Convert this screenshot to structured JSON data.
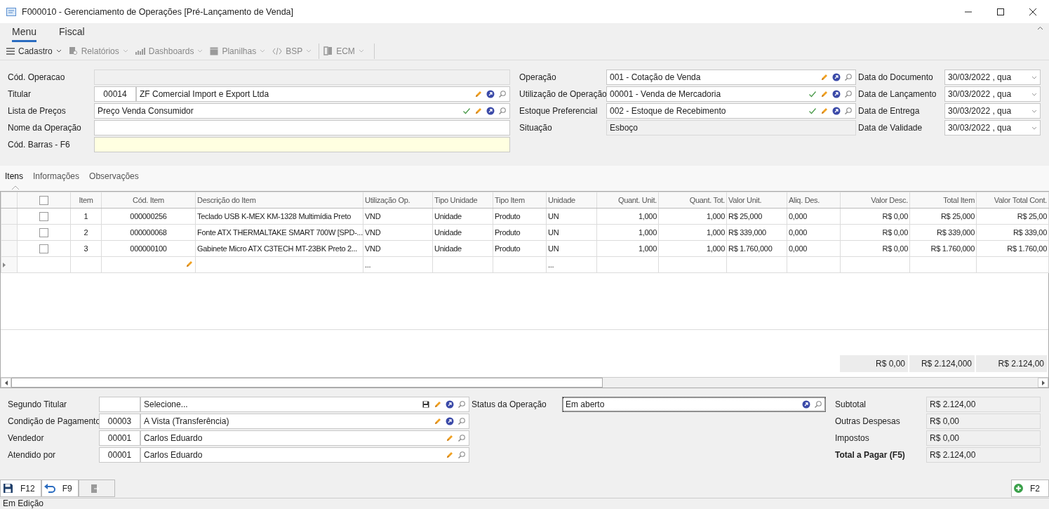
{
  "window": {
    "title": "F000010 - Gerenciamento de Operações [Pré-Lançamento de Venda]"
  },
  "ribbon_tabs": [
    {
      "label": "Menu",
      "selected": true
    },
    {
      "label": "Fiscal",
      "selected": false
    }
  ],
  "toolbar": [
    {
      "label": "Cadastro",
      "kind": "menu",
      "disabled": false
    },
    {
      "label": "Relatórios",
      "kind": "reports",
      "disabled": true
    },
    {
      "label": "Dashboards",
      "kind": "dashboards",
      "disabled": true
    },
    {
      "label": "Planilhas",
      "kind": "sheets",
      "disabled": true
    },
    {
      "label": "BSP",
      "kind": "code",
      "disabled": true
    },
    {
      "label": "ECM",
      "kind": "ecm",
      "disabled": true
    }
  ],
  "header_form": {
    "left": [
      {
        "label": "Cód. Operacao",
        "kind": "readonly"
      },
      {
        "label": "Titular",
        "kind": "lookup",
        "code": "00014",
        "value": "ZF Comercial Import e Export Ltda",
        "editable": true,
        "openable": true,
        "searchable": true
      },
      {
        "label": "Lista de Preços",
        "kind": "lookup",
        "value": "Preço Venda Consumidor",
        "confirmed": true,
        "editable": true,
        "openable": true,
        "searchable": true
      },
      {
        "label": "Nome da Operação",
        "kind": "text"
      },
      {
        "label": "Cód. Barras - F6",
        "kind": "barcode"
      }
    ],
    "middle": [
      {
        "label": "Operação",
        "kind": "lookup",
        "value": "001 - Cotação de Venda",
        "editable": true,
        "openable": true,
        "searchable": true
      },
      {
        "label": "Utilização de Operação",
        "kind": "lookup",
        "value": "00001 - Venda de Mercadoria",
        "confirmed": true,
        "editable": true,
        "openable": true,
        "searchable": true
      },
      {
        "label": "Estoque Preferencial",
        "kind": "lookup",
        "value": "002 - Estoque de Recebimento",
        "confirmed": true,
        "editable": true,
        "openable": true,
        "searchable": true
      },
      {
        "label": "Situação",
        "kind": "readonly",
        "value": "Esboço"
      }
    ],
    "right": [
      {
        "label": "Data do Documento",
        "kind": "date",
        "value": "30/03/2022 ,  qua"
      },
      {
        "label": "Data de Lançamento",
        "kind": "date",
        "value": "30/03/2022 ,  qua"
      },
      {
        "label": "Data de Entrega",
        "kind": "date",
        "value": "30/03/2022 ,  qua"
      },
      {
        "label": "Data de Validade",
        "kind": "date",
        "value": "30/03/2022 ,  qua"
      }
    ]
  },
  "detail_tabs": [
    {
      "label": "Itens",
      "selected": true
    },
    {
      "label": "Informações",
      "selected": false
    },
    {
      "label": "Observações",
      "selected": false
    }
  ],
  "items_grid": {
    "all_checked": false,
    "columns": [
      {
        "label": "Item",
        "kind": "center"
      },
      {
        "label": "Cód. Item",
        "kind": "center"
      },
      {
        "label": "Descrição do Item",
        "kind": "text"
      },
      {
        "label": "Utilização Op.",
        "kind": "text"
      },
      {
        "label": "Tipo Unidade",
        "kind": "text"
      },
      {
        "label": "Tipo Item",
        "kind": "text"
      },
      {
        "label": "Unidade",
        "kind": "text"
      },
      {
        "label": "Quant. Unit.",
        "kind": "number"
      },
      {
        "label": "Quant. Tot.",
        "kind": "number"
      },
      {
        "label": "Valor Unit.",
        "kind": "text"
      },
      {
        "label": "Aliq. Des.",
        "kind": "text"
      },
      {
        "label": "Valor Desc.",
        "kind": "number",
        "total": "R$ 0,00"
      },
      {
        "label": "Total Item",
        "kind": "number",
        "total": "R$ 2.124,000"
      },
      {
        "label": "Valor Total Cont.",
        "kind": "number",
        "total": "R$ 2.124,00"
      }
    ],
    "rows": [
      {
        "checked": false,
        "cells": [
          "1",
          "000000256",
          "Teclado USB K-MEX KM-1328 Multimídia Preto",
          "VND",
          "Unidade",
          "Produto",
          "UN",
          "1,000",
          "1,000",
          "R$ 25,000",
          "0,000",
          "R$ 0,00",
          "R$ 25,000",
          "R$ 25,00"
        ]
      },
      {
        "checked": false,
        "cells": [
          "2",
          "000000068",
          "Fonte ATX THERMALTAKE SMART 700W [SPD-...",
          "VND",
          "Unidade",
          "Produto",
          "UN",
          "1,000",
          "1,000",
          "R$ 339,000",
          "0,000",
          "R$ 0,00",
          "R$ 339,000",
          "R$ 339,00"
        ]
      },
      {
        "checked": false,
        "cells": [
          "3",
          "000000100",
          "Gabinete Micro ATX C3TECH MT-23BK Preto 2...",
          "VND",
          "Unidade",
          "Produto",
          "UN",
          "1,000",
          "1,000",
          "R$ 1.760,000",
          "0,000",
          "R$ 0,00",
          "R$ 1.760,000",
          "R$ 1.760,00"
        ]
      }
    ],
    "new_row": {
      "utilizacao": "...",
      "unidade": "..."
    }
  },
  "bottom_form": {
    "left": [
      {
        "label": "Segundo Titular",
        "kind": "coded_lookup",
        "value": "Selecione...",
        "saveable": true,
        "editable": true,
        "openable": true,
        "searchable": true
      },
      {
        "label": "Condição de Pagamento",
        "kind": "coded_lookup",
        "code": "00003",
        "value": "A Vista (Transferência)",
        "editable": true,
        "openable": true,
        "searchable": true
      },
      {
        "label": "Vendedor",
        "kind": "coded_lookup",
        "code": "00001",
        "value": "Carlos Eduardo",
        "editable": true,
        "searchable": true
      },
      {
        "label": "Atendido por",
        "kind": "coded_lookup",
        "code": "00001",
        "value": "Carlos Eduardo",
        "editable": true,
        "searchable": true
      }
    ],
    "status": {
      "label": "Status da Operação",
      "value": "Em aberto",
      "focused": true,
      "openable": true,
      "searchable": true
    },
    "summary": [
      {
        "label": "Subtotal",
        "value": "R$ 2.124,00",
        "kind": "normal"
      },
      {
        "label": "Outras Despesas",
        "value": "R$ 0,00",
        "kind": "normal"
      },
      {
        "label": "Impostos",
        "value": "R$ 0,00",
        "kind": "normal"
      },
      {
        "label": "Total a Pagar (F5)",
        "value": "R$ 2.124,00",
        "kind": "total"
      }
    ]
  },
  "footer_buttons": [
    {
      "kind": "save",
      "label": "F12",
      "disabled": false
    },
    {
      "kind": "undo",
      "label": "F9",
      "disabled": false
    },
    {
      "kind": "exit",
      "disabled": true
    }
  ],
  "add_button": {
    "label": "F2"
  },
  "status_bar": {
    "text": "Em Edição"
  }
}
